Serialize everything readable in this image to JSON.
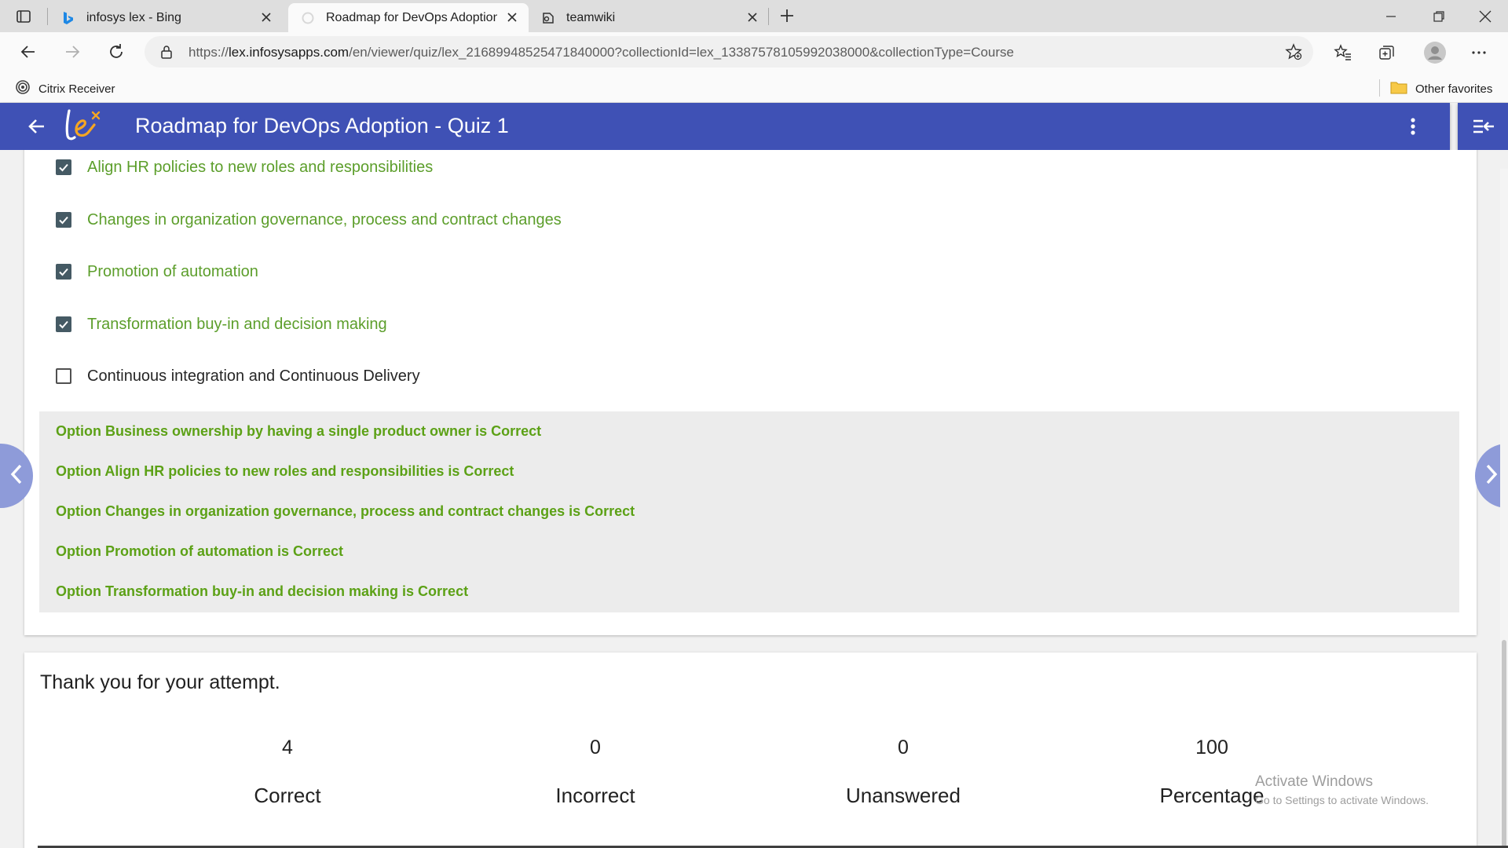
{
  "browser": {
    "tabs": [
      {
        "title": "infosys lex - Bing",
        "icon": "bing-icon"
      },
      {
        "title": "Roadmap for DevOps Adoption",
        "icon": "loading-icon"
      },
      {
        "title": "teamwiki",
        "icon": "wiki-icon"
      }
    ],
    "url_prefix": "https://",
    "url_host": "lex.infosysapps.com",
    "url_path": "/en/viewer/quiz/lex_21689948525471840000?collectionId=lex_13387578105992038000&collectionType=Course",
    "favorites": {
      "citrix": "Citrix Receiver",
      "other": "Other favorites"
    }
  },
  "app": {
    "title": "Roadmap for DevOps Adoption - Quiz 1",
    "brand_color": "#3f51b5"
  },
  "question": {
    "options": [
      {
        "label": "Align HR policies to new roles and responsibilities",
        "checked": true
      },
      {
        "label": "Changes in organization governance, process and contract changes",
        "checked": true
      },
      {
        "label": "Promotion of automation",
        "checked": true
      },
      {
        "label": "Transformation buy-in and decision making",
        "checked": true
      },
      {
        "label": "Continuous integration and Continuous Delivery",
        "checked": false
      }
    ],
    "feedback": [
      "Option Business ownership by having a single product owner is Correct",
      "Option Align HR policies to new roles and responsibilities is Correct",
      "Option Changes in organization governance, process and contract changes is Correct",
      "Option Promotion of automation is Correct",
      "Option Transformation buy-in and decision making is Correct"
    ],
    "correct_color": "#5c9e2b"
  },
  "result": {
    "thanks": "Thank you for your attempt.",
    "stats": [
      {
        "value": "4",
        "label": "Correct"
      },
      {
        "value": "0",
        "label": "Incorrect"
      },
      {
        "value": "0",
        "label": "Unanswered"
      },
      {
        "value": "100",
        "label": "Percentage"
      }
    ]
  },
  "watermark": {
    "line1": "Activate Windows",
    "line2": "Go to Settings to activate Windows."
  }
}
